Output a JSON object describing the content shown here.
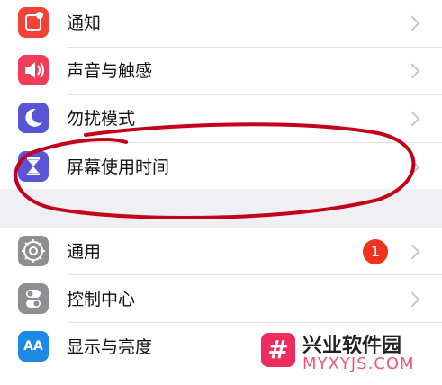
{
  "group1": {
    "items": [
      {
        "label": "通知",
        "icon": "notification-icon",
        "color": "#f44336"
      },
      {
        "label": "声音与触感",
        "icon": "speaker-icon",
        "color": "#f03d5a"
      },
      {
        "label": "勿扰模式",
        "icon": "moon-icon",
        "color": "#5856d6"
      },
      {
        "label": "屏幕使用时间",
        "icon": "hourglass-icon",
        "color": "#5856d6"
      }
    ]
  },
  "group2": {
    "items": [
      {
        "label": "通用",
        "icon": "gear-icon",
        "color": "#8e8e93",
        "badge": "1"
      },
      {
        "label": "控制中心",
        "icon": "toggle-icon",
        "color": "#8e8e93"
      },
      {
        "label": "显示与亮度",
        "icon": "aa-icon",
        "color": "#1e88e5",
        "icon_text": "AA"
      }
    ]
  },
  "watermark": {
    "name": "兴业软件园",
    "domain": "MYXYJS.COM",
    "logo_symbol": "#"
  },
  "annotation": {
    "color": "#c4001a"
  }
}
